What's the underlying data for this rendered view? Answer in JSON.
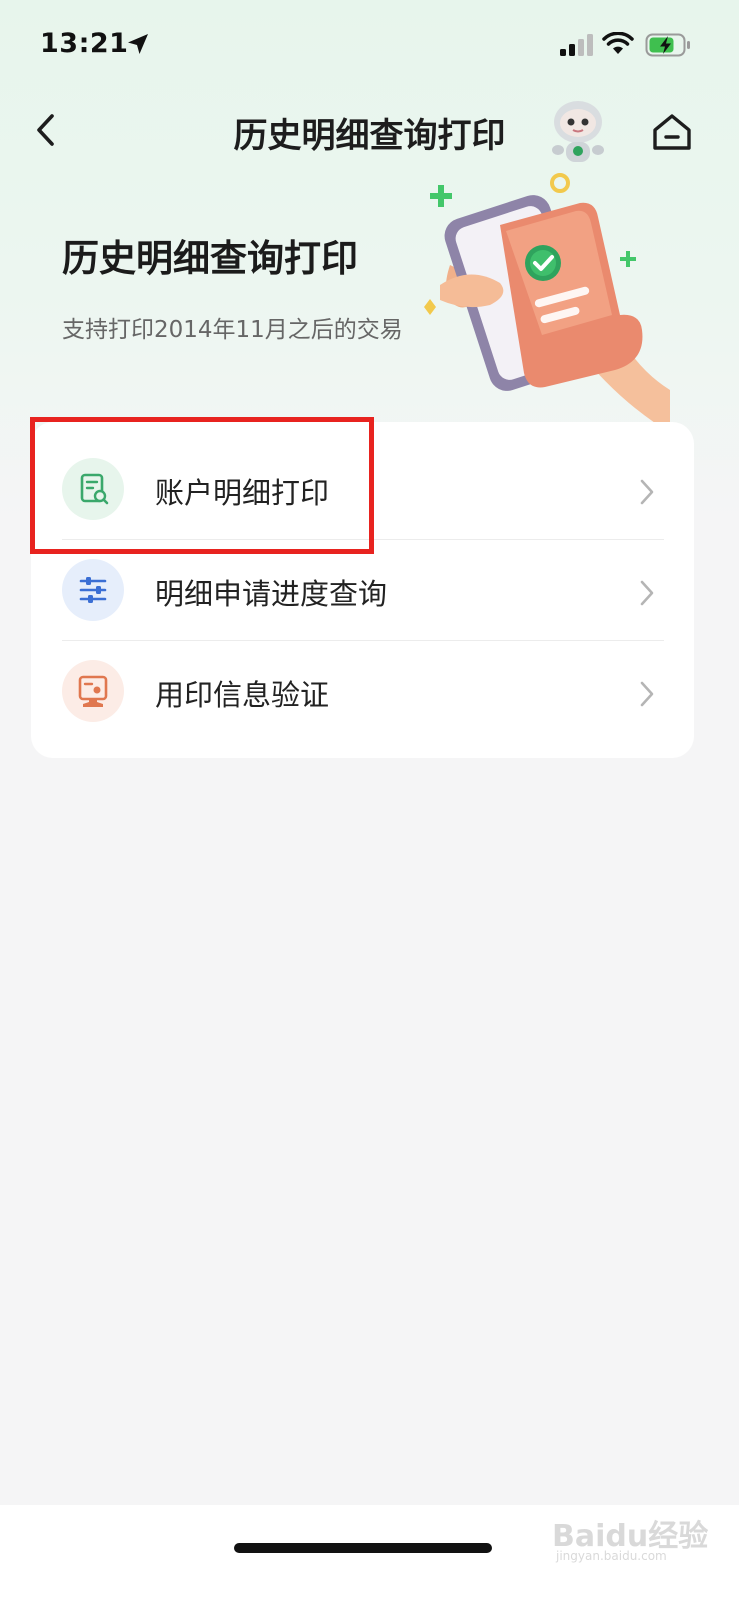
{
  "status_bar": {
    "time": "13:21",
    "icons": [
      "location-arrow-icon",
      "cellular-signal-icon",
      "wifi-icon",
      "battery-charging-icon"
    ]
  },
  "nav": {
    "title": "历史明细查询打印",
    "back_icon": "chevron-left-icon",
    "assistant_icon": "robot-assistant-icon",
    "home_icon": "home-icon"
  },
  "hero": {
    "title": "历史明细查询打印",
    "subtitle": "支持打印2014年11月之后的交易"
  },
  "menu": {
    "items": [
      {
        "label": "账户明细打印",
        "icon": "document-search-icon",
        "color": "#3aa86b",
        "bg": "#e7f5ec"
      },
      {
        "label": "明细申请进度查询",
        "icon": "sliders-icon",
        "color": "#3b6fd4",
        "bg": "#e6eefb"
      },
      {
        "label": "用印信息验证",
        "icon": "seal-stamp-icon",
        "color": "#e0774f",
        "bg": "#fcece6"
      }
    ]
  },
  "highlight": {
    "color": "#e8231f",
    "target": "账户明细打印"
  },
  "watermark": {
    "text": "Baidu经验",
    "sub": "jingyan.baidu.com"
  },
  "colors": {
    "accent": "#3aa86b",
    "background": "#f5f5f6",
    "card": "#ffffff"
  }
}
